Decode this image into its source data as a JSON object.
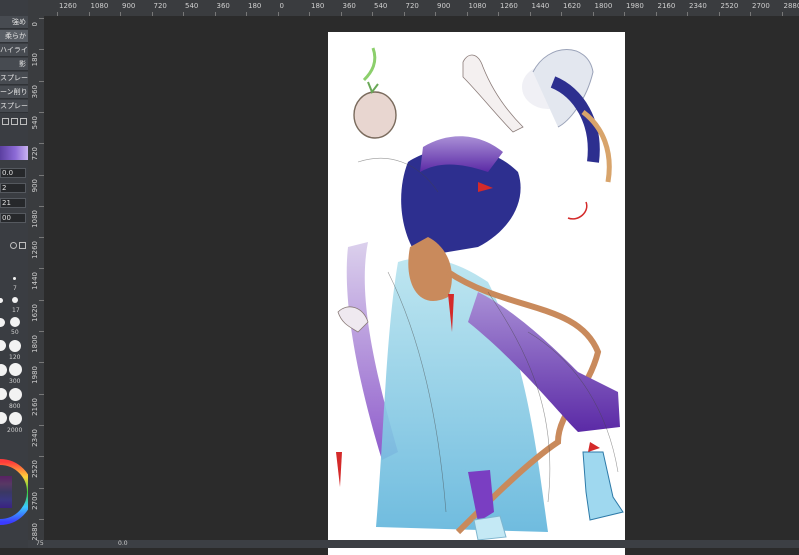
{
  "left_panel": {
    "tool_items": [
      "強め",
      "柔らか",
      "ハイライト",
      "影",
      "スプレー",
      "ーン削り",
      "スプレー"
    ],
    "values": [
      "0.0",
      "2",
      "21",
      "00"
    ],
    "brush_size_labels": [
      "7",
      "17",
      "50",
      "120",
      "300",
      "800",
      "2000"
    ]
  },
  "rulers": {
    "horizontal": [
      "1260",
      "1080",
      "900",
      "720",
      "540",
      "360",
      "180",
      "0",
      "180",
      "360",
      "540",
      "720",
      "900",
      "1080",
      "1260",
      "1440",
      "1620",
      "1800",
      "1980",
      "2160",
      "2340",
      "2520",
      "2700",
      "2880"
    ],
    "vertical": [
      "0",
      "180",
      "360",
      "540",
      "720",
      "900",
      "1080",
      "1260",
      "1440",
      "1620",
      "1800",
      "1980",
      "2160",
      "2340",
      "2520",
      "2700",
      "2880"
    ]
  },
  "status_bar": {
    "zoom": "75",
    "angle": "0.0"
  },
  "colors": {
    "canvas": "#ffffff",
    "workspace": "#2b2b2b",
    "ruler": "#3a3c3f",
    "panel": "#3a3d42"
  }
}
